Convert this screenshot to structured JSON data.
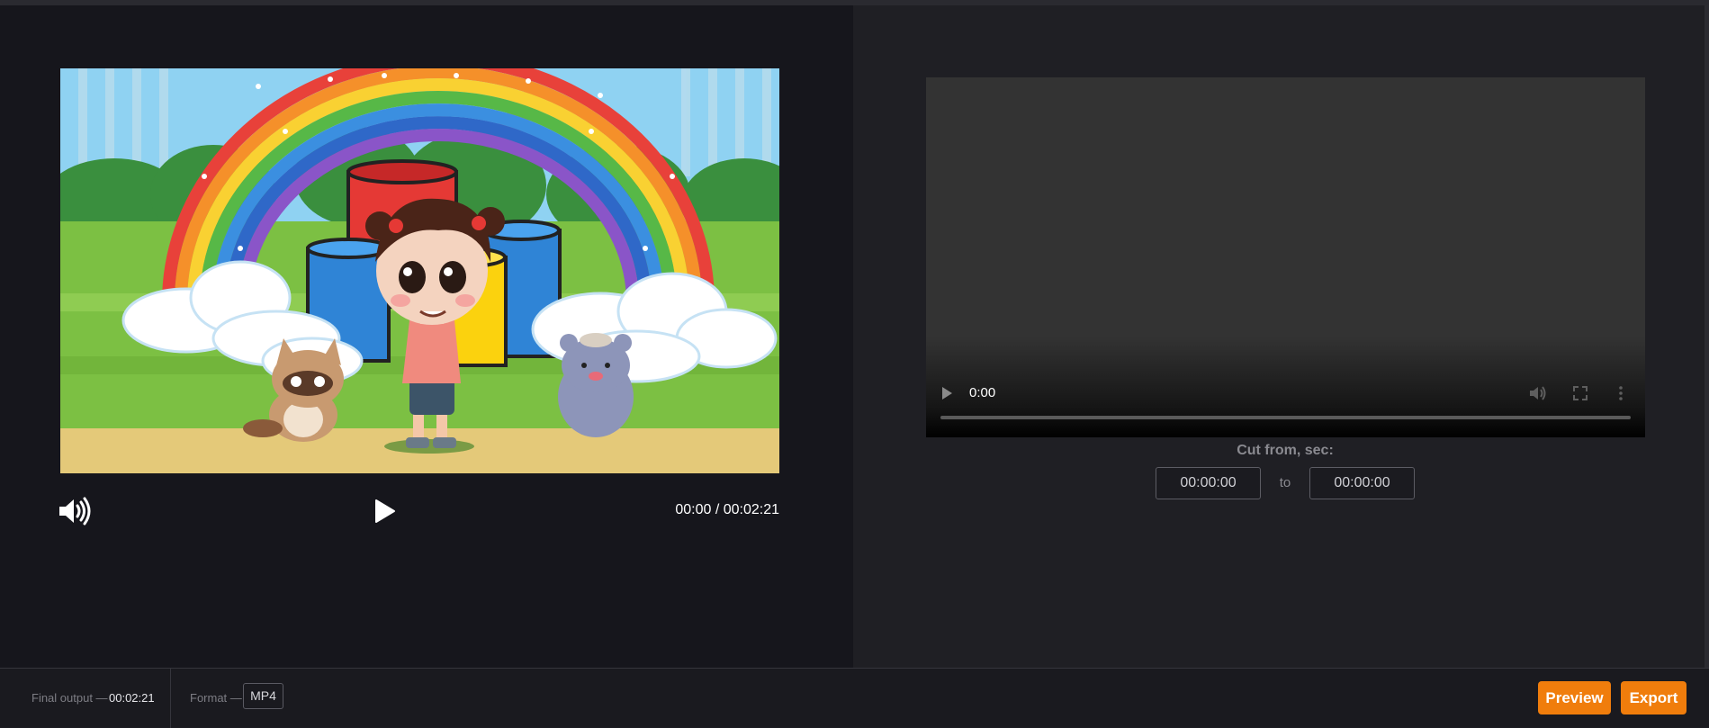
{
  "left_player": {
    "timecode": "00:00 / 00:02:21",
    "sound_icon": "speaker-volume-icon",
    "play_icon": "play-icon"
  },
  "right_player": {
    "time": "0:00",
    "play_icon": "play-icon",
    "volume_icon": "volume-icon",
    "fullscreen_icon": "fullscreen-icon",
    "menu_icon": "more-vertical-icon",
    "progress": 0
  },
  "cut": {
    "label": "Cut from, sec:",
    "from_value": "00:00:00",
    "separator": "to",
    "to_value": "00:00:00"
  },
  "footer": {
    "final_output_label": "Final output —",
    "final_output_value": "00:02:21",
    "format_label": "Format —",
    "format_value": "MP4",
    "preview_label": "Preview",
    "export_label": "Export"
  },
  "colors": {
    "accent": "#f07d0c",
    "left_bg": "#16161c",
    "right_bg": "#1f1f24"
  }
}
